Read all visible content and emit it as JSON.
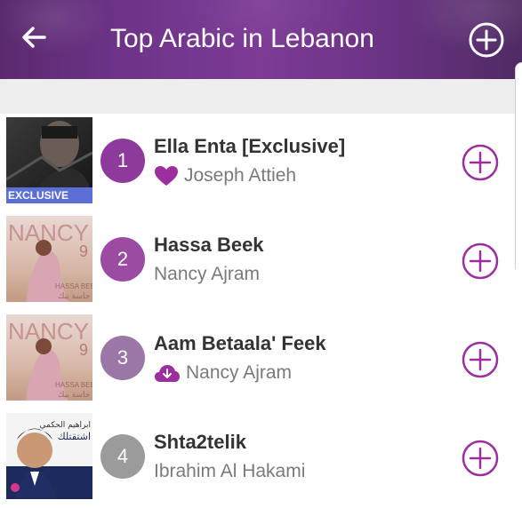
{
  "header": {
    "title": "Top Arabic in Lebanon",
    "back_icon": "arrow-left-icon",
    "add_icon": "plus-circle-icon"
  },
  "colors": {
    "accent": "#9b2f9e",
    "rank1": "#8e3a9c",
    "rank2": "#9b4ba2",
    "rank3": "#9a77a4",
    "rank4": "#9b9b9b"
  },
  "tracks": [
    {
      "rank": "1",
      "title": "Ella Enta [Exclusive]",
      "artist": "Joseph Attieh",
      "status_icon": "heart-icon",
      "badge": "EXCLUSIVE"
    },
    {
      "rank": "2",
      "title": "Hassa Beek",
      "artist": "Nancy Ajram",
      "status_icon": ""
    },
    {
      "rank": "3",
      "title": "Aam Betaala' Feek",
      "artist": "Nancy Ajram",
      "status_icon": "cloud-download-icon"
    },
    {
      "rank": "4",
      "title": "Shta2telik",
      "artist": "Ibrahim Al Hakami",
      "status_icon": ""
    }
  ],
  "album_art": {
    "nancy_text": "NANCY",
    "nancy_number": "9",
    "nancy_subtitle": "HASSA BEEK",
    "nancy_arabic": "حاسة بيك",
    "ibrahim_name": "ابراهيم الحكمي",
    "ibrahim_title": "اشتقتلك"
  }
}
